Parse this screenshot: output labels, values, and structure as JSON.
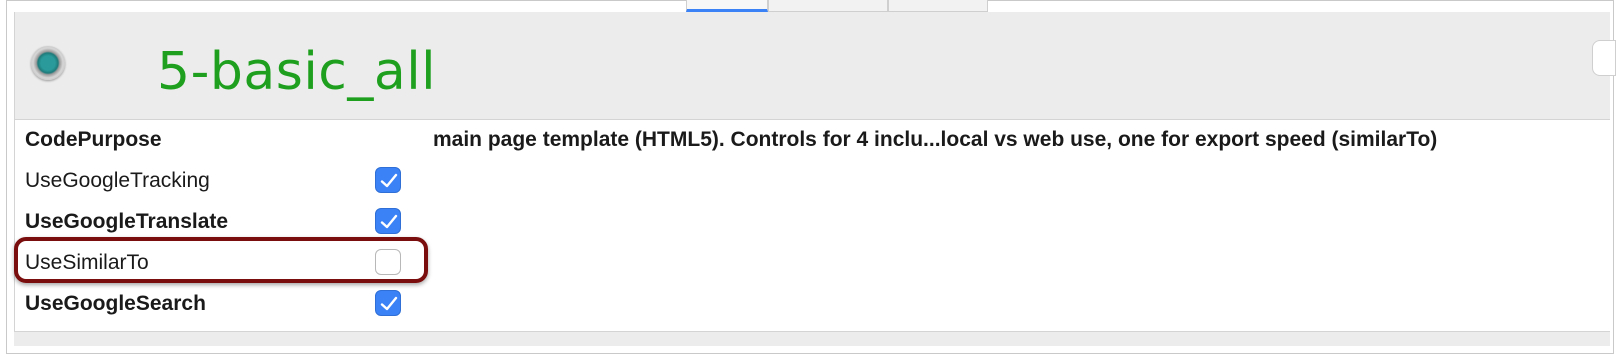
{
  "header": {
    "title": "5-basic_all"
  },
  "table": {
    "code_purpose": {
      "label": "CodePurpose",
      "value": "main page template (HTML5). Controls for 4 inclu...local vs web use, one for export speed (similarTo)"
    },
    "rows": [
      {
        "label": "UseGoogleTracking",
        "checked": true
      },
      {
        "label": "UseGoogleTranslate",
        "checked": true
      },
      {
        "label": "UseSimilarTo",
        "checked": false
      },
      {
        "label": "UseGoogleSearch",
        "checked": true
      }
    ]
  },
  "colors": {
    "title_green": "#1ea01e",
    "checkbox_blue": "#3b82f6",
    "highlight_red": "#7a0d0d"
  }
}
